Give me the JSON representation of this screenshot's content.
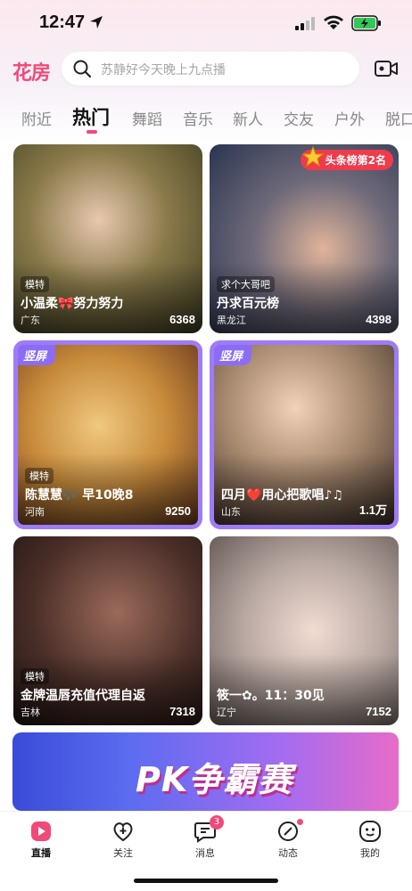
{
  "status": {
    "time": "12:47"
  },
  "header": {
    "logo": "花房",
    "search_placeholder": "苏静好今天晚上九点播"
  },
  "tabs": [
    "附近",
    "热门",
    "舞蹈",
    "音乐",
    "新人",
    "交友",
    "户外",
    "脱口"
  ],
  "active_tab": "热门",
  "cards": [
    {
      "tag": "模特",
      "title": "小温柔🎀努力努力",
      "location": "广东",
      "count": "6368",
      "vertical": false
    },
    {
      "tag": "求个大哥吧",
      "title": "丹求百元榜",
      "location": "黑龙江",
      "count": "4398",
      "vertical": false,
      "rank_badge": "头条榜第2名"
    },
    {
      "tag": "模特",
      "title": "陈慧慧🎶 早10晚8",
      "location": "河南",
      "count": "9250",
      "vertical": true,
      "vertical_label": "竖屏"
    },
    {
      "tag": "",
      "title": "四月❤️用心把歌唱♪♫",
      "location": "山东",
      "count": "1.1万",
      "vertical": true,
      "vertical_label": "竖屏"
    },
    {
      "tag": "模特",
      "title": "金牌温唇充值代理自返",
      "location": "吉林",
      "count": "7318",
      "vertical": false
    },
    {
      "tag": "",
      "title": "筱一✿。11：30见",
      "location": "辽宁",
      "count": "7152",
      "vertical": false
    }
  ],
  "banner": {
    "title": "PK争霸赛"
  },
  "bottom_nav": [
    {
      "label": "直播",
      "icon": "live-icon",
      "active": true
    },
    {
      "label": "关注",
      "icon": "follow-icon",
      "active": false
    },
    {
      "label": "消息",
      "icon": "message-icon",
      "active": false,
      "badge": "3"
    },
    {
      "label": "动态",
      "icon": "feed-icon",
      "active": false
    },
    {
      "label": "我的",
      "icon": "profile-icon",
      "active": false
    }
  ],
  "colors": {
    "brand": "#f04a78",
    "vertical_border": "#9e7cf7",
    "rank_badge": "#ef3b4b"
  }
}
